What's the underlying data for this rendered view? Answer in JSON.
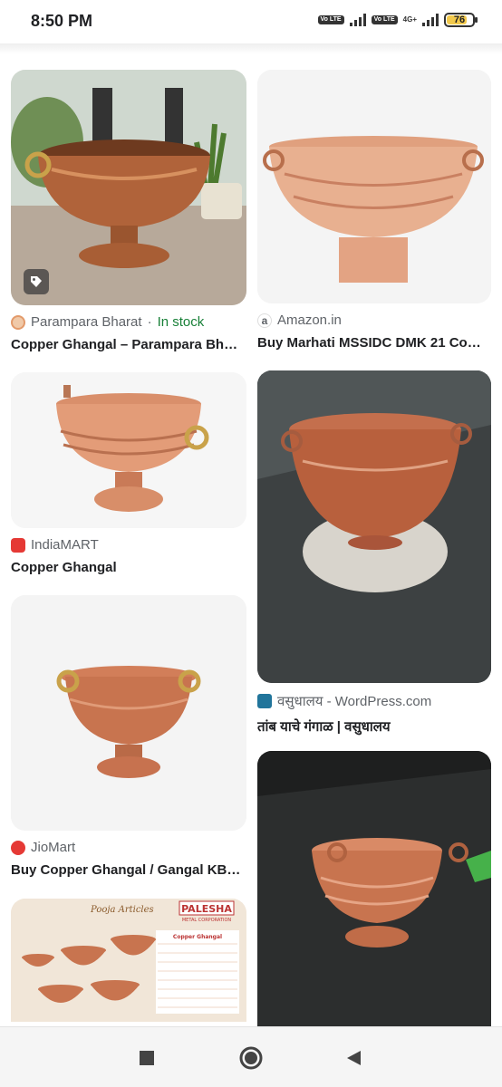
{
  "status": {
    "time": "8:50 PM",
    "battery": "76",
    "volte1": "Vo LTE",
    "volte2": "Vo LTE",
    "net": "4G+"
  },
  "results": [
    {
      "source": "Parampara Bharat",
      "stock": "In stock",
      "title": "Copper Ghangal – Parampara Bh…",
      "source_icon": "parampara-icon"
    },
    {
      "source": "Amazon.in",
      "title": "Buy Marhati MSSIDC DMK 21 Co…",
      "source_icon": "amazon-icon"
    },
    {
      "source": "IndiaMART",
      "title": "Copper Ghangal",
      "source_icon": "indiamart-icon"
    },
    {
      "source": "वसुधालय - WordPress.com",
      "title": "तांब याचे गंगाळ | वसुधालय",
      "source_icon": "wordpress-icon"
    },
    {
      "source": "JioMart",
      "title": "Buy Copper Ghangal / Gangal KB…",
      "source_icon": "jiomart-icon"
    },
    {
      "image_text": "Pooja Articles",
      "brand": "PALESHA",
      "brand_sub": "METAL CORPORATION",
      "table_title": "Copper Ghangal"
    },
    {}
  ],
  "nav": {
    "back": "back-icon",
    "home": "home-icon",
    "recents": "recents-icon"
  },
  "colors": {
    "copper": "#c8794f",
    "instock": "#188038"
  }
}
